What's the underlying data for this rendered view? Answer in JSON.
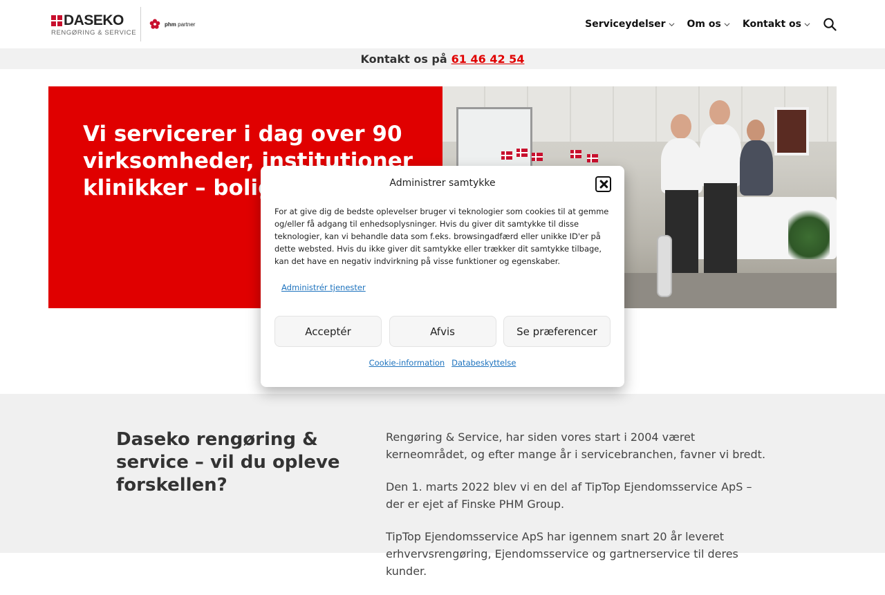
{
  "header": {
    "logo": {
      "word": "DASEKO",
      "sub": "RENGØRING & SERVICE",
      "partner_bold": "phm",
      "partner_text": "partner"
    },
    "nav": [
      {
        "label": "Serviceydelser"
      },
      {
        "label": "Om os"
      },
      {
        "label": "Kontakt os"
      }
    ],
    "icons": {
      "chevron": "chevron-down-icon",
      "search": "search-icon"
    }
  },
  "contact_bar": {
    "text": "Kontakt os på",
    "phone": "61 46 42 54"
  },
  "hero": {
    "title": "Vi servicerer i dag over 90 virksomheder, institutioner klinikker – boligforeninger"
  },
  "info": {
    "title": "Daseko rengøring & service – vil du opleve forskellen?",
    "paragraphs": [
      "Rengøring & Service, har siden vores start i 2004 været kerneområdet, og efter mange år i servicebranchen, favner vi bredt.",
      "Den 1. marts 2022 blev vi en del af TipTop Ejendomsservice ApS – der er ejet af Finske PHM Group.",
      "TipTop Ejendomsservice ApS har igennem snart 20 år leveret erhvervsrengøring, Ejendomsservice og gartnerservice til deres kunder."
    ]
  },
  "cookie_modal": {
    "title": "Administrer samtykke",
    "body": "For at give dig de bedste oplevelser bruger vi teknologier som cookies til at gemme og/eller få adgang til enhedsoplysninger. Hvis du giver dit samtykke til disse teknologier, kan vi behandle data som f.eks. browsingadfærd eller unikke ID'er på dette websted. Hvis du ikke giver dit samtykke eller trækker dit samtykke tilbage, kan det have en negativ indvirkning på visse funktioner og egenskaber.",
    "manage_link": "Administrér tjenester",
    "buttons": {
      "accept": "Acceptér",
      "deny": "Afvis",
      "preferences": "Se præferencer"
    },
    "links": {
      "cookie_info": "Cookie-information",
      "privacy": "Databeskyttelse"
    }
  },
  "colors": {
    "brand_red": "#e00000",
    "link_blue": "#1e73be"
  }
}
